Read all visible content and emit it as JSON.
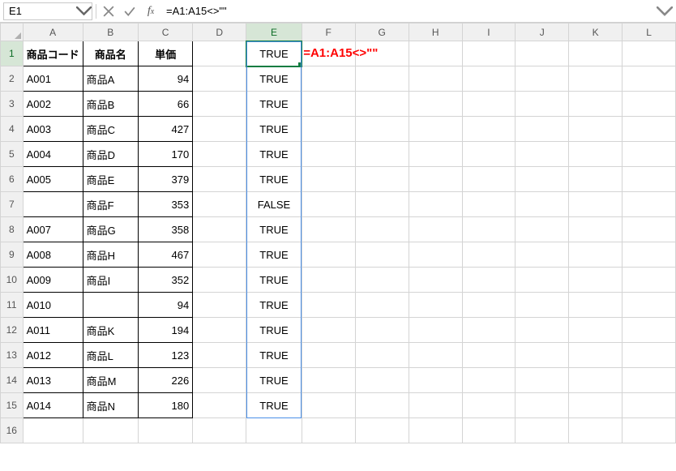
{
  "formula_bar": {
    "name_box": "E1",
    "formula": "=A1:A15<>\"\""
  },
  "columns": [
    "A",
    "B",
    "C",
    "D",
    "E",
    "F",
    "G",
    "H",
    "I",
    "J",
    "K",
    "L"
  ],
  "headers": {
    "A": "商品コード",
    "B": "商品名",
    "C": "単価"
  },
  "rows": [
    {
      "A": "A001",
      "B": "商品A",
      "C": 94
    },
    {
      "A": "A002",
      "B": "商品B",
      "C": 66
    },
    {
      "A": "A003",
      "B": "商品C",
      "C": 427
    },
    {
      "A": "A004",
      "B": "商品D",
      "C": 170
    },
    {
      "A": "A005",
      "B": "商品E",
      "C": 379
    },
    {
      "A": "",
      "B": "商品F",
      "C": 353
    },
    {
      "A": "A007",
      "B": "商品G",
      "C": 358
    },
    {
      "A": "A008",
      "B": "商品H",
      "C": 467
    },
    {
      "A": "A009",
      "B": "商品I",
      "C": 352
    },
    {
      "A": "A010",
      "B": "",
      "C": 94
    },
    {
      "A": "A011",
      "B": "商品K",
      "C": 194
    },
    {
      "A": "A012",
      "B": "商品L",
      "C": 123
    },
    {
      "A": "A013",
      "B": "商品M",
      "C": 226
    },
    {
      "A": "A014",
      "B": "商品N",
      "C": 180
    }
  ],
  "spill": [
    "TRUE",
    "TRUE",
    "TRUE",
    "TRUE",
    "TRUE",
    "TRUE",
    "FALSE",
    "TRUE",
    "TRUE",
    "TRUE",
    "TRUE",
    "TRUE",
    "TRUE",
    "TRUE",
    "TRUE"
  ],
  "annotation": "=A1:A15<>\"\"",
  "active_cell": "E1",
  "visible_rows": 16
}
